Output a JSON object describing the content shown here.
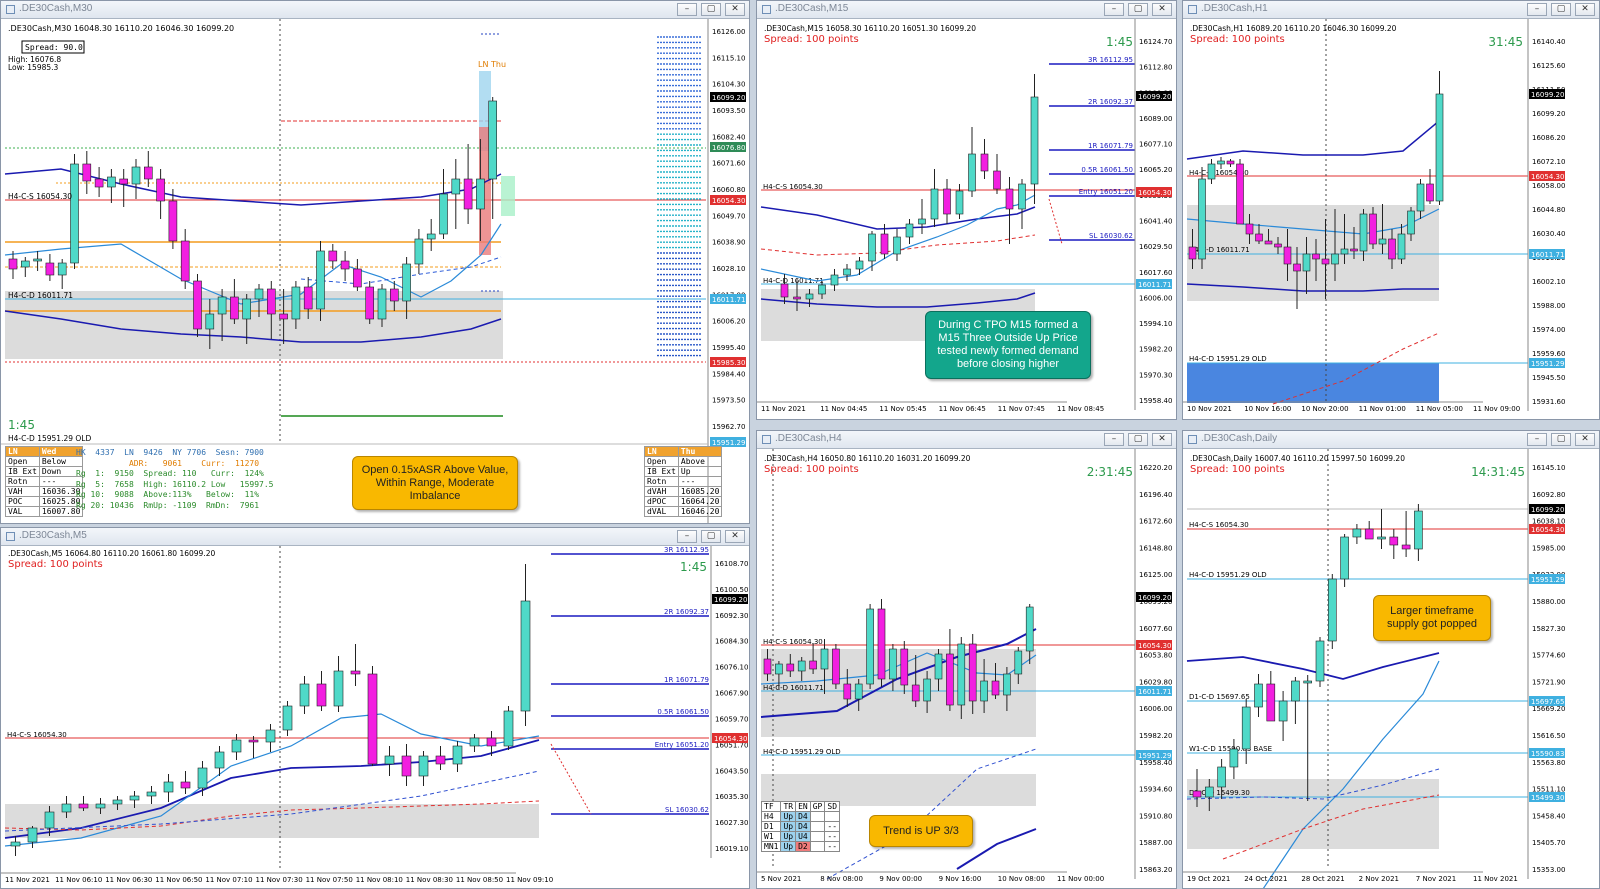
{
  "windows": [
    {
      "id": "m30",
      "title": ".DE30Cash,M30",
      "header": ".DE30Cash,M30  16048.30 16110.20 16046.30 16099.20",
      "timer": "1:45"
    },
    {
      "id": "m15",
      "title": ".DE30Cash,M15",
      "header": ".DE30Cash,M15  16058.30 16110.20 16051.30 16099.20",
      "spread": "Spread: 100 points",
      "timer": "1:45"
    },
    {
      "id": "h1",
      "title": ".DE30Cash,H1",
      "header": ".DE30Cash,H1  16089.20 16110.20 16046.30 16099.20",
      "spread": "Spread: 100 points",
      "timer": "31:45"
    },
    {
      "id": "m5",
      "title": ".DE30Cash,M5",
      "header": ".DE30Cash,M5  16064.80 16110.20 16061.80 16099.20",
      "spread": "Spread: 100 points",
      "timer": "1:45"
    },
    {
      "id": "h4",
      "title": ".DE30Cash,H4",
      "header": ".DE30Cash,H4  16050.80 16110.20 16031.20 16099.20",
      "spread": "Spread: 100 points",
      "timer": "2:31:45"
    },
    {
      "id": "daily",
      "title": ".DE30Cash,Daily",
      "header": ".DE30Cash,Daily  16007.40 16110.20 15997.50 16099.20",
      "spread": "Spread: 100 points",
      "timer": "14:31:45"
    }
  ],
  "m30": {
    "spread_box": "Spread: 90.0",
    "high": "High: 16076.8",
    "low": "Low: 15985.3",
    "ln_thu": "LN Thu",
    "levels": [
      "H4-C-S 16054.30",
      "H4-C-D 16011.71",
      "H4-C-D 15951.29 OLD"
    ],
    "price_axis": [
      "16126.00",
      "16115.10",
      "16104.30",
      "16093.50",
      "16082.40",
      "16071.60",
      "16060.80",
      "16049.70",
      "16038.90",
      "16028.10",
      "16017.00",
      "16006.20",
      "15995.40",
      "15984.40",
      "15973.50",
      "15962.70"
    ],
    "price_tags": [
      {
        "v": "16099.20",
        "c": "#000000"
      },
      {
        "v": "16076.80",
        "c": "#2e8b57"
      },
      {
        "v": "16054.30",
        "c": "#e03030"
      },
      {
        "v": "16011.71",
        "c": "#3fb0e0"
      },
      {
        "v": "15985.30",
        "c": "#e03030"
      },
      {
        "v": "15951.29",
        "c": "#3fb0e0"
      }
    ],
    "left_table": {
      "header": [
        "LN",
        "Wed"
      ],
      "rows": [
        [
          "Open",
          "Below"
        ],
        [
          "IB Ext",
          "Down"
        ],
        [
          "Rotn",
          "---"
        ],
        [
          "VAH",
          "16036.30"
        ],
        [
          "POC",
          "16025.80"
        ],
        [
          "VAL",
          "16007.80"
        ]
      ]
    },
    "stats": [
      "HK  4337  LN  9426  NY 7706  Sesn: 7900",
      "           ADR:   9061    Curr:  11270",
      "Rg  1:  9150  Spread: 110   Curr:  124%",
      "Rg  5:  7658  High: 16110.2 Low   15997.5",
      "Rg 10:  9088  Above:113%   Below:  11%",
      "Rg 20: 10436  RmUp: -1109  RmDn:  7961"
    ],
    "right_table": {
      "header": [
        "LN",
        "Thu"
      ],
      "rows": [
        [
          "Open",
          "Above"
        ],
        [
          "IB Ext",
          "Up"
        ],
        [
          "Rotn",
          "---"
        ],
        [
          "dVAH",
          "16085.20"
        ],
        [
          "dPOC",
          "16064.20"
        ],
        [
          "dVAL",
          "16046.20"
        ]
      ]
    },
    "callout": "Open 0.15xASR Above Value, Within Range, Moderate Imbalance"
  },
  "m15": {
    "levels": [
      "3R 16112.95",
      "2R 16092.37",
      "1R 16071.79",
      "0.5R 16061.50",
      "Entry 16051.20",
      "SL 16030.62"
    ],
    "zone_labels": [
      "H4-C-S 16054.30",
      "H4-C-D 16011.71"
    ],
    "price_axis": [
      "16124.70",
      "16112.80",
      "16100.90",
      "16089.00",
      "16077.10",
      "16065.20",
      "16053.30",
      "16041.40",
      "16029.50",
      "16017.60",
      "16006.00",
      "15994.10",
      "15982.20",
      "15970.30",
      "15958.40"
    ],
    "price_tags": [
      {
        "v": "16099.20",
        "c": "#000000"
      },
      {
        "v": "16054.30",
        "c": "#e03030"
      },
      {
        "v": "16011.71",
        "c": "#3fb0e0"
      }
    ],
    "time_axis": [
      "11 Nov 2021",
      "11 Nov 04:45",
      "11 Nov 05:45",
      "11 Nov 06:45",
      "11 Nov 07:45",
      "11 Nov 08:45"
    ],
    "callout": "During C TPO M15 formed a M15 Three Outside Up Price tested newly formed demand before closing higher"
  },
  "h1": {
    "zone_labels": [
      "H4-C-S 16054.30",
      "H4-C-D 16011.71",
      "H4-C-D 15951.29 OLD"
    ],
    "price_axis": [
      "16140.40",
      "16125.60",
      "16111.50",
      "16099.20",
      "16086.20",
      "16072.10",
      "16058.00",
      "16044.80",
      "16030.40",
      "16016.20",
      "16002.10",
      "15988.00",
      "15974.00",
      "15959.60",
      "15945.50",
      "15931.60"
    ],
    "price_tags": [
      {
        "v": "16099.20",
        "c": "#000000"
      },
      {
        "v": "16054.30",
        "c": "#e03030"
      },
      {
        "v": "16011.71",
        "c": "#3fb0e0"
      },
      {
        "v": "15951.29",
        "c": "#3fb0e0"
      }
    ],
    "time_axis": [
      "10 Nov 2021",
      "10 Nov 16:00",
      "10 Nov 20:00",
      "11 Nov 01:00",
      "11 Nov 05:00",
      "11 Nov 09:00"
    ]
  },
  "m5": {
    "levels": [
      "3R 16112.95",
      "2R 16092.37",
      "1R 16071.79",
      "0.5R 16061.50",
      "Entry 16051.20",
      "SL 16030.62"
    ],
    "zone_labels": [
      "H4-C-S 16054.30"
    ],
    "price_axis": [
      "16108.70",
      "16100.50",
      "16092.30",
      "16084.30",
      "16076.10",
      "16067.90",
      "16059.70",
      "16051.70",
      "16043.50",
      "16035.30",
      "16027.30",
      "16019.10"
    ],
    "price_tags": [
      {
        "v": "16099.20",
        "c": "#000000"
      },
      {
        "v": "16054.30",
        "c": "#e03030"
      }
    ],
    "time_axis": [
      "11 Nov 2021",
      "11 Nov 06:10",
      "11 Nov 06:30",
      "11 Nov 06:50",
      "11 Nov 07:10",
      "11 Nov 07:30",
      "11 Nov 07:50",
      "11 Nov 08:10",
      "11 Nov 08:30",
      "11 Nov 08:50",
      "11 Nov 09:10"
    ]
  },
  "h4": {
    "zone_labels": [
      "H4-C-S 16054.30",
      "H4-C-D 16011.71",
      "H4-C-D 15951.29 OLD"
    ],
    "price_axis": [
      "16220.20",
      "16196.40",
      "16172.60",
      "16148.80",
      "16125.00",
      "16099.20",
      "16077.60",
      "16053.80",
      "16029.80",
      "16006.00",
      "15982.20",
      "15958.40",
      "15934.60",
      "15910.80",
      "15887.00",
      "15863.20"
    ],
    "price_tags": [
      {
        "v": "16099.20",
        "c": "#000000"
      },
      {
        "v": "16054.30",
        "c": "#e03030"
      },
      {
        "v": "16011.71",
        "c": "#3fb0e0"
      },
      {
        "v": "15951.29",
        "c": "#3fb0e0"
      }
    ],
    "time_axis": [
      "5 Nov 2021",
      "8 Nov 08:00",
      "9 Nov 00:00",
      "9 Nov 16:00",
      "10 Nov 08:00",
      "11 Nov 00:00"
    ],
    "tf_table": {
      "header": [
        "TF",
        "TR",
        "EN",
        "GP",
        "SD"
      ],
      "rows": [
        [
          "H4",
          "Up",
          "D4",
          "",
          ""
        ],
        [
          "D1",
          "Up",
          "D4",
          "",
          "--"
        ],
        [
          "W1",
          "Up",
          "U4",
          "",
          "--"
        ],
        [
          "MN1",
          "Up",
          "D2",
          "",
          "--"
        ]
      ]
    },
    "callout": "Trend is UP 3/3"
  },
  "daily": {
    "zone_labels": [
      "H4-C-S 16054.30",
      "H4-C-D 15951.29 OLD",
      "D1-C-D 15697.65",
      "W1-C-D 15590.83 BASE",
      "D1-C-D 15499.30"
    ],
    "price_axis": [
      "16145.10",
      "16092.80",
      "16038.10",
      "15985.00",
      "15932.00",
      "15880.00",
      "15827.30",
      "15774.60",
      "15721.90",
      "15669.20",
      "15616.50",
      "15563.80",
      "15511.10",
      "15458.40",
      "15405.70",
      "15353.00"
    ],
    "price_tags": [
      {
        "v": "16099.20",
        "c": "#000000"
      },
      {
        "v": "16054.30",
        "c": "#e03030"
      },
      {
        "v": "15951.29",
        "c": "#3fb0e0"
      },
      {
        "v": "15697.65",
        "c": "#3fb0e0"
      },
      {
        "v": "15590.83",
        "c": "#3fb0e0"
      },
      {
        "v": "15499.30",
        "c": "#3fb0e0"
      }
    ],
    "time_axis": [
      "19 Oct 2021",
      "24 Oct 2021",
      "28 Oct 2021",
      "2 Nov 2021",
      "7 Nov 2021",
      "11 Nov 2021"
    ],
    "callout": "Larger timeframe supply got popped"
  },
  "colors": {
    "bull": "#4fd9c8",
    "bear": "#f21fe0",
    "support": "#e03030",
    "demand": "#3fb0e0",
    "ma": "#1a1ab0",
    "callout": "#f9b800"
  }
}
